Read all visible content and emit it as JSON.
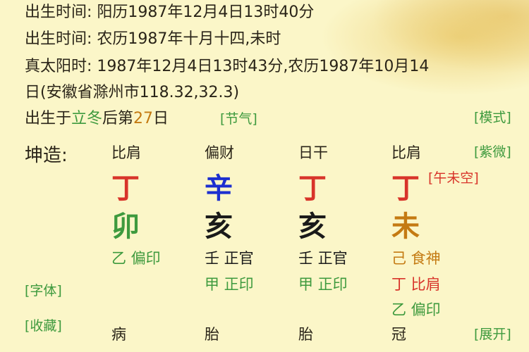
{
  "info": {
    "line1": "出生时间: 阳历1987年12月4日13时40分",
    "line2": "出生时间: 农历1987年十月十四,未时",
    "line3": "真太阳时: 1987年12月4日13时43分,农历1987年10月14",
    "line4": "日(安徽省滁州市118.32,32.3)",
    "born_prefix": "出生于",
    "solar_term": "立冬",
    "born_mid": "后第",
    "days": "27",
    "born_suffix": "日"
  },
  "tags": {
    "jieqi": "[节气]",
    "moshi": "[模式]",
    "ziwei": "[紫微]",
    "ziti": "[字体]",
    "shoucang": "[收藏]",
    "zhankai": "[展开]",
    "kong": "[午未空]"
  },
  "chart": {
    "label": "坤造:",
    "pillars": [
      {
        "header": "比肩",
        "stem": "丁",
        "branch": "卯",
        "hidden": [
          "乙 偏印"
        ],
        "stage": "病"
      },
      {
        "header": "偏财",
        "stem": "辛",
        "branch": "亥",
        "hidden": [
          "壬 正官",
          "甲 正印"
        ],
        "stage": "胎"
      },
      {
        "header": "日干",
        "stem": "丁",
        "branch": "亥",
        "hidden": [
          "壬 正官",
          "甲 正印"
        ],
        "stage": "胎"
      },
      {
        "header": "比肩",
        "stem": "丁",
        "branch": "未",
        "hidden": [
          "己 食神",
          "丁 比肩",
          "乙 偏印"
        ],
        "stage": "冠"
      }
    ]
  },
  "colors": {
    "background": "#fbf6c8",
    "green": "#3e9a3e",
    "red": "#d8342a",
    "blue": "#1c2fd0",
    "orange": "#c47a12"
  }
}
